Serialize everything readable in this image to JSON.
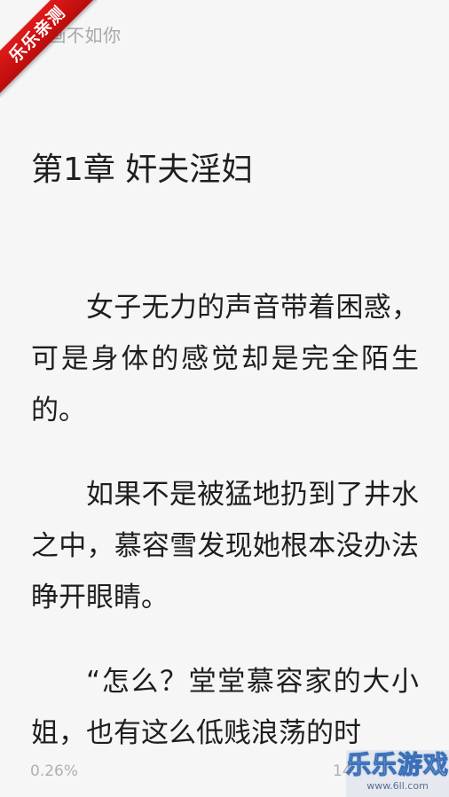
{
  "header": {
    "book_title": "如画不如你",
    "ribbon_label": "乐乐亲测"
  },
  "chapter": {
    "title": "第1章 奸夫淫妇",
    "paragraphs": [
      "女子无力的声音带着困惑，可是身体的感觉却是完全陌生的。",
      "如果不是被猛地扔到了井水之中，慕容雪发现她根本没办法睁开眼睛。",
      "“怎么？堂堂慕容家的大小姐，也有这么低贱浪荡的时"
    ]
  },
  "footer": {
    "progress": "0.26%",
    "page_partial": "14"
  },
  "watermark": {
    "text": "乐乐游戏",
    "url": "www.6ll.com"
  },
  "colors": {
    "background": "#f6f6f6",
    "text": "#1e1e1e",
    "muted": "#a8a8a8",
    "ribbon": "#d01414"
  }
}
